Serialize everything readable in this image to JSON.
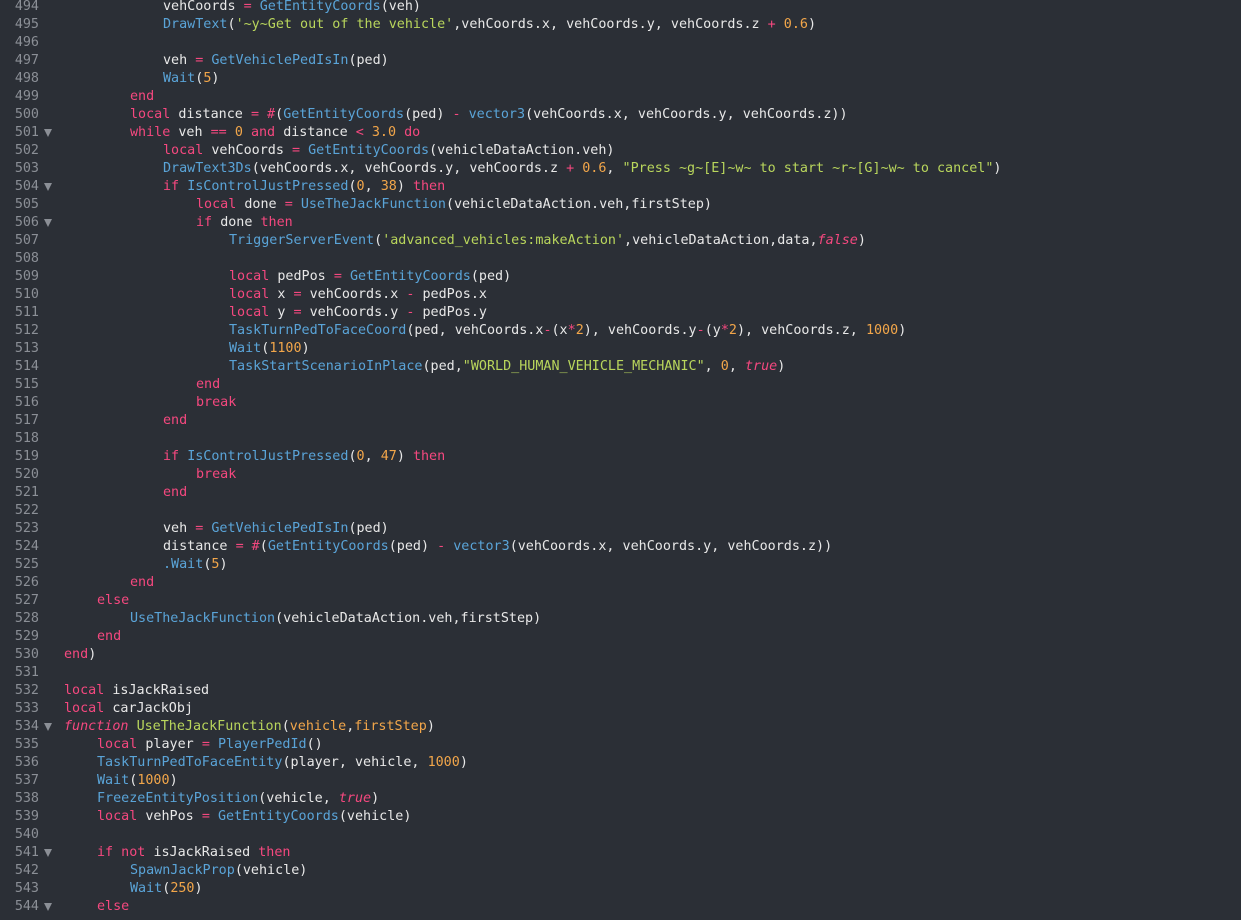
{
  "editor": {
    "lines": [
      {
        "n": "494",
        "fold": false,
        "indent": 4,
        "tokens": [
          [
            "id",
            "vehCoords "
          ],
          [
            "op",
            "= "
          ],
          [
            "fn",
            "GetEntityCoords"
          ],
          [
            "id",
            "(veh)"
          ]
        ]
      },
      {
        "n": "495",
        "fold": false,
        "indent": 4,
        "tokens": [
          [
            "fn",
            "DrawText"
          ],
          [
            "id",
            "("
          ],
          [
            "str",
            "'~y~Get out of the vehicle'"
          ],
          [
            "id",
            ",vehCoords.x, vehCoords.y, vehCoords.z "
          ],
          [
            "op",
            "+ "
          ],
          [
            "num",
            "0.6"
          ],
          [
            "id",
            ")"
          ]
        ]
      },
      {
        "n": "496",
        "fold": false,
        "indent": 0,
        "tokens": []
      },
      {
        "n": "497",
        "fold": false,
        "indent": 4,
        "tokens": [
          [
            "id",
            "veh "
          ],
          [
            "op",
            "= "
          ],
          [
            "fn",
            "GetVehiclePedIsIn"
          ],
          [
            "id",
            "(ped)"
          ]
        ]
      },
      {
        "n": "498",
        "fold": false,
        "indent": 4,
        "tokens": [
          [
            "fn",
            "Wait"
          ],
          [
            "id",
            "("
          ],
          [
            "num",
            "5"
          ],
          [
            "id",
            ")"
          ]
        ]
      },
      {
        "n": "499",
        "fold": false,
        "indent": 3,
        "tokens": [
          [
            "kw",
            "end"
          ]
        ]
      },
      {
        "n": "500",
        "fold": false,
        "indent": 3,
        "tokens": [
          [
            "kw",
            "local "
          ],
          [
            "id",
            "distance "
          ],
          [
            "op",
            "= #"
          ],
          [
            "id",
            "("
          ],
          [
            "fn",
            "GetEntityCoords"
          ],
          [
            "id",
            "(ped) "
          ],
          [
            "op",
            "- "
          ],
          [
            "fn",
            "vector3"
          ],
          [
            "id",
            "(vehCoords.x, vehCoords.y, vehCoords.z))"
          ]
        ]
      },
      {
        "n": "501",
        "fold": true,
        "indent": 3,
        "tokens": [
          [
            "kw",
            "while "
          ],
          [
            "id",
            "veh "
          ],
          [
            "op",
            "== "
          ],
          [
            "num",
            "0 "
          ],
          [
            "kw",
            "and "
          ],
          [
            "id",
            "distance "
          ],
          [
            "op",
            "< "
          ],
          [
            "num",
            "3.0 "
          ],
          [
            "kw",
            "do"
          ]
        ]
      },
      {
        "n": "502",
        "fold": false,
        "indent": 4,
        "tokens": [
          [
            "kw",
            "local "
          ],
          [
            "id",
            "vehCoords "
          ],
          [
            "op",
            "= "
          ],
          [
            "fn",
            "GetEntityCoords"
          ],
          [
            "id",
            "(vehicleDataAction.veh)"
          ]
        ]
      },
      {
        "n": "503",
        "fold": false,
        "indent": 4,
        "tokens": [
          [
            "fn",
            "DrawText3Ds"
          ],
          [
            "id",
            "(vehCoords.x, vehCoords.y, vehCoords.z "
          ],
          [
            "op",
            "+ "
          ],
          [
            "num",
            "0.6"
          ],
          [
            "id",
            ", "
          ],
          [
            "str",
            "\"Press ~g~[E]~w~ to start ~r~[G]~w~ to cancel\""
          ],
          [
            "id",
            ")"
          ]
        ]
      },
      {
        "n": "504",
        "fold": true,
        "indent": 4,
        "tokens": [
          [
            "kw",
            "if "
          ],
          [
            "fn",
            "IsControlJustPressed"
          ],
          [
            "id",
            "("
          ],
          [
            "num",
            "0"
          ],
          [
            "id",
            ", "
          ],
          [
            "num",
            "38"
          ],
          [
            "id",
            ") "
          ],
          [
            "kw",
            "then"
          ]
        ]
      },
      {
        "n": "505",
        "fold": false,
        "indent": 5,
        "tokens": [
          [
            "kw",
            "local "
          ],
          [
            "id",
            "done "
          ],
          [
            "op",
            "= "
          ],
          [
            "fn",
            "UseTheJackFunction"
          ],
          [
            "id",
            "(vehicleDataAction.veh,firstStep)"
          ]
        ]
      },
      {
        "n": "506",
        "fold": true,
        "indent": 5,
        "tokens": [
          [
            "kw",
            "if "
          ],
          [
            "id",
            "done "
          ],
          [
            "kw",
            "then"
          ]
        ]
      },
      {
        "n": "507",
        "fold": false,
        "indent": 6,
        "tokens": [
          [
            "fn",
            "TriggerServerEvent"
          ],
          [
            "id",
            "("
          ],
          [
            "str",
            "'advanced_vehicles:makeAction'"
          ],
          [
            "id",
            ",vehicleDataAction,data,"
          ],
          [
            "it",
            "false"
          ],
          [
            "id",
            ")"
          ]
        ]
      },
      {
        "n": "508",
        "fold": false,
        "indent": 0,
        "tokens": []
      },
      {
        "n": "509",
        "fold": false,
        "indent": 6,
        "tokens": [
          [
            "kw",
            "local "
          ],
          [
            "id",
            "pedPos "
          ],
          [
            "op",
            "= "
          ],
          [
            "fn",
            "GetEntityCoords"
          ],
          [
            "id",
            "(ped)"
          ]
        ]
      },
      {
        "n": "510",
        "fold": false,
        "indent": 6,
        "tokens": [
          [
            "kw",
            "local "
          ],
          [
            "id",
            "x "
          ],
          [
            "op",
            "= "
          ],
          [
            "id",
            "vehCoords.x "
          ],
          [
            "op",
            "- "
          ],
          [
            "id",
            "pedPos.x"
          ]
        ]
      },
      {
        "n": "511",
        "fold": false,
        "indent": 6,
        "tokens": [
          [
            "kw",
            "local "
          ],
          [
            "id",
            "y "
          ],
          [
            "op",
            "= "
          ],
          [
            "id",
            "vehCoords.y "
          ],
          [
            "op",
            "- "
          ],
          [
            "id",
            "pedPos.y"
          ]
        ]
      },
      {
        "n": "512",
        "fold": false,
        "indent": 6,
        "tokens": [
          [
            "fn",
            "TaskTurnPedToFaceCoord"
          ],
          [
            "id",
            "(ped, vehCoords.x"
          ],
          [
            "op",
            "-"
          ],
          [
            "id",
            "(x"
          ],
          [
            "op",
            "*"
          ],
          [
            "num",
            "2"
          ],
          [
            "id",
            "), vehCoords.y"
          ],
          [
            "op",
            "-"
          ],
          [
            "id",
            "(y"
          ],
          [
            "op",
            "*"
          ],
          [
            "num",
            "2"
          ],
          [
            "id",
            "), vehCoords.z, "
          ],
          [
            "num",
            "1000"
          ],
          [
            "id",
            ")"
          ]
        ]
      },
      {
        "n": "513",
        "fold": false,
        "indent": 6,
        "tokens": [
          [
            "fn",
            "Wait"
          ],
          [
            "id",
            "("
          ],
          [
            "num",
            "1100"
          ],
          [
            "id",
            ")"
          ]
        ]
      },
      {
        "n": "514",
        "fold": false,
        "indent": 6,
        "tokens": [
          [
            "fn",
            "TaskStartScenarioInPlace"
          ],
          [
            "id",
            "(ped,"
          ],
          [
            "str",
            "\"WORLD_HUMAN_VEHICLE_MECHANIC\""
          ],
          [
            "id",
            ", "
          ],
          [
            "num",
            "0"
          ],
          [
            "id",
            ", "
          ],
          [
            "it",
            "true"
          ],
          [
            "id",
            ")"
          ]
        ]
      },
      {
        "n": "515",
        "fold": false,
        "indent": 5,
        "tokens": [
          [
            "kw",
            "end"
          ]
        ]
      },
      {
        "n": "516",
        "fold": false,
        "indent": 5,
        "tokens": [
          [
            "kw",
            "break"
          ]
        ]
      },
      {
        "n": "517",
        "fold": false,
        "indent": 4,
        "tokens": [
          [
            "kw",
            "end"
          ]
        ]
      },
      {
        "n": "518",
        "fold": false,
        "indent": 0,
        "tokens": []
      },
      {
        "n": "519",
        "fold": false,
        "indent": 4,
        "tokens": [
          [
            "kw",
            "if "
          ],
          [
            "fn",
            "IsControlJustPressed"
          ],
          [
            "id",
            "("
          ],
          [
            "num",
            "0"
          ],
          [
            "id",
            ", "
          ],
          [
            "num",
            "47"
          ],
          [
            "id",
            ") "
          ],
          [
            "kw",
            "then"
          ]
        ]
      },
      {
        "n": "520",
        "fold": false,
        "indent": 5,
        "tokens": [
          [
            "kw",
            "break"
          ]
        ]
      },
      {
        "n": "521",
        "fold": false,
        "indent": 4,
        "tokens": [
          [
            "kw",
            "end"
          ]
        ]
      },
      {
        "n": "522",
        "fold": false,
        "indent": 0,
        "tokens": []
      },
      {
        "n": "523",
        "fold": false,
        "indent": 4,
        "tokens": [
          [
            "id",
            "veh "
          ],
          [
            "op",
            "= "
          ],
          [
            "fn",
            "GetVehiclePedIsIn"
          ],
          [
            "id",
            "(ped)"
          ]
        ]
      },
      {
        "n": "524",
        "fold": false,
        "indent": 4,
        "tokens": [
          [
            "id",
            "distance "
          ],
          [
            "op",
            "= #"
          ],
          [
            "id",
            "("
          ],
          [
            "fn",
            "GetEntityCoords"
          ],
          [
            "id",
            "(ped) "
          ],
          [
            "op",
            "- "
          ],
          [
            "fn",
            "vector3"
          ],
          [
            "id",
            "(vehCoords.x, vehCoords.y, vehCoords.z))"
          ]
        ]
      },
      {
        "n": "525",
        "fold": false,
        "indent": 4,
        "tokens": [
          [
            "fn",
            ".Wait"
          ],
          [
            "id",
            "("
          ],
          [
            "num",
            "5"
          ],
          [
            "id",
            ")"
          ]
        ]
      },
      {
        "n": "526",
        "fold": false,
        "indent": 3,
        "tokens": [
          [
            "kw",
            "end"
          ]
        ]
      },
      {
        "n": "527",
        "fold": false,
        "indent": 2,
        "tokens": [
          [
            "kw",
            "else"
          ]
        ]
      },
      {
        "n": "528",
        "fold": false,
        "indent": 3,
        "tokens": [
          [
            "fn",
            "UseTheJackFunction"
          ],
          [
            "id",
            "(vehicleDataAction.veh,firstStep)"
          ]
        ]
      },
      {
        "n": "529",
        "fold": false,
        "indent": 2,
        "tokens": [
          [
            "kw",
            "end"
          ]
        ]
      },
      {
        "n": "530",
        "fold": false,
        "indent": 1,
        "tokens": [
          [
            "kw",
            "end"
          ],
          [
            "id",
            ")"
          ]
        ]
      },
      {
        "n": "531",
        "fold": false,
        "indent": 0,
        "tokens": []
      },
      {
        "n": "532",
        "fold": false,
        "indent": 1,
        "tokens": [
          [
            "kw",
            "local "
          ],
          [
            "id",
            "isJackRaised"
          ]
        ]
      },
      {
        "n": "533",
        "fold": false,
        "indent": 1,
        "tokens": [
          [
            "kw",
            "local "
          ],
          [
            "id",
            "carJackObj"
          ]
        ]
      },
      {
        "n": "534",
        "fold": true,
        "indent": 1,
        "tokens": [
          [
            "it",
            "function "
          ],
          [
            "fni",
            "UseTheJackFunction"
          ],
          [
            "id",
            "("
          ],
          [
            "par",
            "vehicle"
          ],
          [
            "id",
            ","
          ],
          [
            "par",
            "firstStep"
          ],
          [
            "id",
            ")"
          ]
        ]
      },
      {
        "n": "535",
        "fold": false,
        "indent": 2,
        "tokens": [
          [
            "kw",
            "local "
          ],
          [
            "id",
            "player "
          ],
          [
            "op",
            "= "
          ],
          [
            "fn",
            "PlayerPedId"
          ],
          [
            "id",
            "()"
          ]
        ]
      },
      {
        "n": "536",
        "fold": false,
        "indent": 2,
        "tokens": [
          [
            "fn",
            "TaskTurnPedToFaceEntity"
          ],
          [
            "id",
            "(player, vehicle, "
          ],
          [
            "num",
            "1000"
          ],
          [
            "id",
            ")"
          ]
        ]
      },
      {
        "n": "537",
        "fold": false,
        "indent": 2,
        "tokens": [
          [
            "fn",
            "Wait"
          ],
          [
            "id",
            "("
          ],
          [
            "num",
            "1000"
          ],
          [
            "id",
            ")"
          ]
        ]
      },
      {
        "n": "538",
        "fold": false,
        "indent": 2,
        "tokens": [
          [
            "fn",
            "FreezeEntityPosition"
          ],
          [
            "id",
            "(vehicle, "
          ],
          [
            "it",
            "true"
          ],
          [
            "id",
            ")"
          ]
        ]
      },
      {
        "n": "539",
        "fold": false,
        "indent": 2,
        "tokens": [
          [
            "kw",
            "local "
          ],
          [
            "id",
            "vehPos "
          ],
          [
            "op",
            "= "
          ],
          [
            "fn",
            "GetEntityCoords"
          ],
          [
            "id",
            "(vehicle)"
          ]
        ]
      },
      {
        "n": "540",
        "fold": false,
        "indent": 0,
        "tokens": []
      },
      {
        "n": "541",
        "fold": true,
        "indent": 2,
        "tokens": [
          [
            "kw",
            "if not "
          ],
          [
            "id",
            "isJackRaised "
          ],
          [
            "kw",
            "then"
          ]
        ]
      },
      {
        "n": "542",
        "fold": false,
        "indent": 3,
        "tokens": [
          [
            "fn",
            "SpawnJackProp"
          ],
          [
            "id",
            "(vehicle)"
          ]
        ]
      },
      {
        "n": "543",
        "fold": false,
        "indent": 3,
        "tokens": [
          [
            "fn",
            "Wait"
          ],
          [
            "id",
            "("
          ],
          [
            "num",
            "250"
          ],
          [
            "id",
            ")"
          ]
        ]
      },
      {
        "n": "544",
        "fold": true,
        "indent": 2,
        "tokens": [
          [
            "kw",
            "else"
          ]
        ]
      }
    ]
  }
}
